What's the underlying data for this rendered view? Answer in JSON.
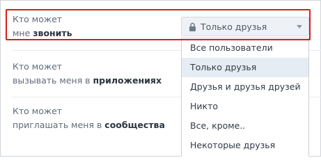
{
  "rows": [
    {
      "prefix": "Кто может",
      "line2_plain": "мне ",
      "line2_bold": "звонить"
    },
    {
      "prefix": "Кто может",
      "line2_plain": "вызывать меня в ",
      "line2_bold": "приложениях"
    },
    {
      "prefix": "Кто может",
      "line2_plain": "приглашать меня в ",
      "line2_bold": "сообщества"
    }
  ],
  "select": {
    "value": "Только друзья",
    "icon": "lock-icon"
  },
  "dropdown": {
    "selected_index": 1,
    "items": [
      "Все пользователи",
      "Только друзья",
      "Друзья и друзья друзей",
      "Никто",
      "Все, кроме..",
      "Некоторые друзья"
    ]
  },
  "colors": {
    "highlight": "#d71d1d",
    "selected_bg": "#e6ecf3"
  }
}
